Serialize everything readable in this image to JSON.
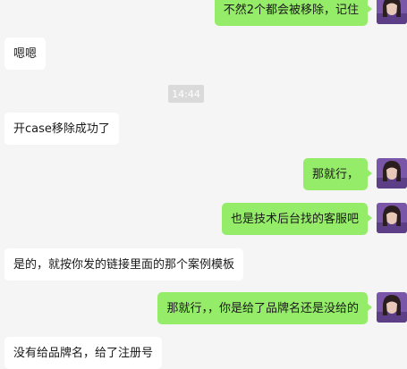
{
  "chat": {
    "timestamp": "14:44",
    "messages": [
      {
        "side": "out",
        "text": "不然2个都会被移除，记住"
      },
      {
        "side": "in",
        "text": "嗯嗯"
      },
      {
        "side": "in",
        "text": "开case移除成功了"
      },
      {
        "side": "out",
        "text": "那就行，"
      },
      {
        "side": "out",
        "text": "也是技术后台找的客服吧"
      },
      {
        "side": "in",
        "text": "是的，就按你发的链接里面的那个案例模板"
      },
      {
        "side": "out",
        "text": "那就行，，你是给了品牌名还是没给的"
      },
      {
        "side": "in",
        "text": "没有给品牌名，给了注册号"
      }
    ]
  },
  "colors": {
    "background": "#f5f5f5",
    "outgoing_bubble": "#95ec69",
    "incoming_bubble": "#ffffff",
    "timestamp_badge": "#dadada"
  }
}
